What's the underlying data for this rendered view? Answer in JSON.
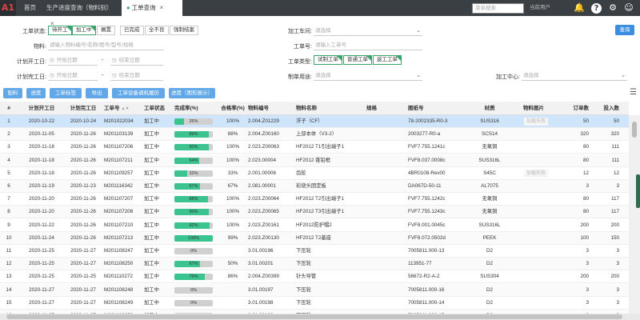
{
  "topbar": {
    "logo": "A1",
    "tabs": [
      {
        "label": "首页"
      },
      {
        "label": "生产进度查询（物料别）"
      },
      {
        "label": "工单查询"
      }
    ],
    "search_placeholder": "菜单搜索",
    "current_user": "当前用户"
  },
  "filters": {
    "status_label": "工单状态:",
    "status_chips": [
      "待开工",
      "加工中",
      "搁置",
      "已完成",
      "全不良",
      "强制结案"
    ],
    "workshop_label": "加工车间:",
    "workshop_placeholder": "请选择",
    "material_label": "物料:",
    "material_placeholder": "请输入物料编号/名称/图号/型号/规格",
    "wo_label": "工单号:",
    "wo_placeholder": "请输入工单号",
    "plan_start_label": "计划开工日:",
    "plan_end_label": "计划完工日:",
    "start_date_ph": "开始日期",
    "end_date_ph": "结束日期",
    "dash": "-",
    "type_label": "工单类型:",
    "type_chips": [
      "试制工单",
      "普通工单",
      "返工工单"
    ],
    "purpose_label": "制单用途:",
    "purpose_placeholder": "请选择",
    "center_label": "加工中心:",
    "center_placeholder": "请选择",
    "query_button": "查询"
  },
  "actions": [
    "配料",
    "进度",
    "工单标签",
    "导出",
    "工单设备调机履历",
    "进度（图形展示）"
  ],
  "table": {
    "headers": [
      "#",
      "计划开工日",
      "计划完工日",
      "工单号",
      "工单状态",
      "完成率(%)",
      "合格率(%)",
      "物料编号",
      "物料名称",
      "规格",
      "图纸号",
      "材质",
      "物料图片",
      "订单数",
      "投入数"
    ],
    "rows": [
      [
        "1",
        "2020-10-22",
        "2020-10-24",
        "M201022034",
        "加工中",
        "26%",
        "100%",
        "2.004.Z01229",
        "浮子（CF）",
        "",
        "78-2002335-R0-3",
        "SUS316",
        "加载失败",
        "50",
        "50"
      ],
      [
        "2",
        "2020-11-05",
        "2020-11-26",
        "M201103139",
        "加工中",
        "89%",
        "88%",
        "2.004.Z00160",
        "上部本体（V3-2）",
        "",
        "2003277-R0-a",
        "SCS14",
        "",
        "320",
        "320"
      ],
      [
        "3",
        "2020-11-18",
        "2020-11-26",
        "M201107206",
        "加工中",
        "90%",
        "100%",
        "2.023.Z00063",
        "HF2012 T1引出端子1",
        "",
        "FVF7.755.1241c",
        "无氧铜",
        "",
        "80",
        "111"
      ],
      [
        "4",
        "2020-11-18",
        "2020-11-26",
        "M201107211",
        "加工中",
        "64%",
        "100%",
        "2.023.00004",
        "HF2012 锥铅框",
        "",
        "FVF8.037.0008c",
        "SUS316L",
        "",
        "80",
        "111"
      ],
      [
        "5",
        "2020-11-18",
        "2020-11-26",
        "M201109257",
        "加工中",
        "33%",
        "33%",
        "2.001.00006",
        "齿轮",
        "",
        "4BR0108-Rev00",
        "S45C",
        "加载失败",
        "12",
        "12"
      ],
      [
        "6",
        "2020-11-19",
        "2020-11-23",
        "M201116342",
        "加工中",
        "67%",
        "67%",
        "2.081.00001",
        "彩烧头固定板",
        "",
        "DA067D-50-11",
        "AL7075",
        "",
        "3",
        "3"
      ],
      [
        "7",
        "2020-11-20",
        "2020-11-26",
        "M201107207",
        "加工中",
        "88%",
        "100%",
        "2.023.Z00064",
        "HF2012 T2引出端子1",
        "",
        "FVF7.755.1242c",
        "无氧铜",
        "",
        "80",
        "117"
      ],
      [
        "8",
        "2020-11-20",
        "2020-11-26",
        "M201107208",
        "加工中",
        "90%",
        "100%",
        "2.023.Z00065",
        "HF2012 T3引出端子1",
        "",
        "FVF7.755.1243c",
        "无氧铜",
        "",
        "80",
        "117"
      ],
      [
        "9",
        "2020-11-22",
        "2020-11-26",
        "M201107210",
        "加工中",
        "92%",
        "100%",
        "2.023.Z00161",
        "HF2012防护帽2",
        "",
        "FVF8.001.0045c",
        "SUS316L",
        "",
        "200",
        "200"
      ],
      [
        "10",
        "2020-11-24",
        "2020-11-26",
        "M201107213",
        "加工中",
        "139%",
        "99%",
        "2.023.Z00130",
        "HF2012 T2基座",
        "",
        "FVF8.072.0502d",
        "PEEK",
        "",
        "100",
        "150"
      ],
      [
        "11",
        "2020-11-25",
        "2020-11-27",
        "M201108247",
        "加工中",
        "0%",
        "",
        "3.01.00196",
        "下压轮",
        "",
        "7005811.000-13",
        "D2",
        "",
        "3",
        "3"
      ],
      [
        "12",
        "2020-11-25",
        "2020-11-27",
        "M201108250",
        "加工中",
        "67%",
        "50%",
        "3.01.00201",
        "下压轮",
        "",
        "113951-77",
        "D2",
        "",
        "3",
        "3"
      ],
      [
        "13",
        "2020-11-25",
        "2020-11-25",
        "M201110272",
        "加工中",
        "79%",
        "86%",
        "2.004.Z00399",
        "针头导管",
        "",
        "56672-R2-A-2",
        "SUS304",
        "",
        "200",
        "200"
      ],
      [
        "14",
        "2020-11-27",
        "2020-11-27",
        "M201108248",
        "加工中",
        "0%",
        "",
        "3.01.00197",
        "下压轮",
        "",
        "7005811.000-16",
        "D2",
        "",
        "3",
        "3"
      ],
      [
        "15",
        "2020-11-27",
        "2020-11-27",
        "M201108249",
        "加工中",
        "0%",
        "",
        "3.01.00198",
        "下压轮",
        "",
        "7005811.000-14",
        "D2",
        "",
        "3",
        "3"
      ],
      [
        "16",
        "2020-11-27",
        "2020-11-27",
        "M201108250",
        "加工中",
        "0%",
        "",
        "3.01.00199",
        "下压轮",
        "",
        "7005811.000-15",
        "D2",
        "",
        "3",
        "3"
      ]
    ],
    "progress": [
      0.26,
      0.89,
      0.9,
      0.64,
      0.33,
      0.67,
      0.88,
      0.9,
      0.92,
      1.0,
      0,
      0.67,
      0.79,
      0,
      0,
      0
    ]
  },
  "colors": {
    "topbar": "#3a3f44",
    "accent": "#3b8de0",
    "progress": "#3bc48f",
    "selected_row": "#cfe5fb"
  }
}
